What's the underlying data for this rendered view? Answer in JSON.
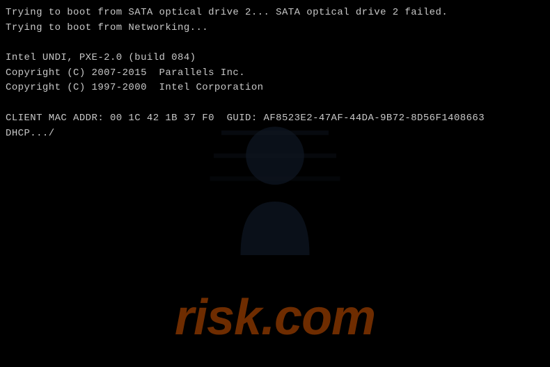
{
  "terminal": {
    "lines": [
      "Trying to boot from SATA optical drive 2... SATA optical drive 2 failed.",
      "Trying to boot from Networking...",
      "",
      "Intel UNDI, PXE-2.0 (build 084)",
      "Copyright (C) 2007-2015  Parallels Inc.",
      "Copyright (C) 1997-2000  Intel Corporation",
      "",
      "CLIENT MAC ADDR: 00 1C 42 1B 37 F0  GUID: AF8523E2-47AF-44DA-9B72-8D56F1408663",
      "DHCP.../"
    ]
  },
  "watermark": {
    "text": "risk.com"
  }
}
